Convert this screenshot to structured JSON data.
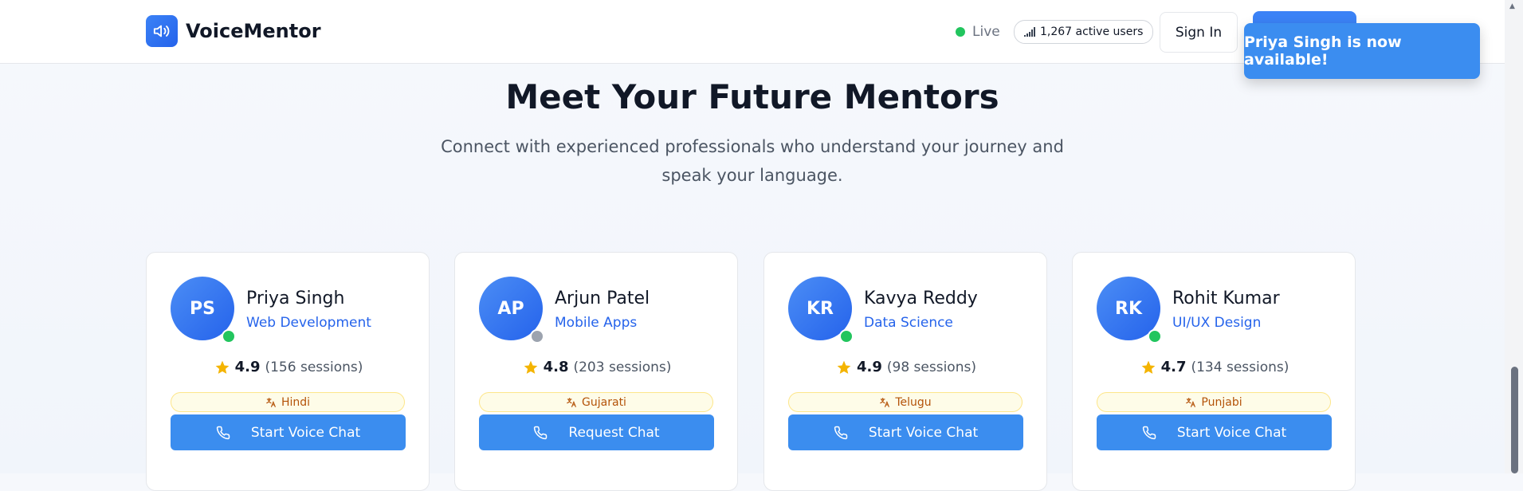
{
  "header": {
    "brand": "VoiceMentor",
    "live_label": "Live",
    "active_users": "1,267 active users",
    "signin_label": "Sign In",
    "toast": "Priya Singh is now available!"
  },
  "hero": {
    "title": "Meet Your Future Mentors",
    "subtitle": "Connect with experienced professionals who understand your journey and speak your language."
  },
  "colors": {
    "online": "#22c55e",
    "offline": "#9ca3af",
    "accent": "#3b82f6"
  },
  "mentors": [
    {
      "initials": "PS",
      "name": "Priya Singh",
      "specialty": "Web Development",
      "rating": "4.9",
      "sessions": "(156 sessions)",
      "language": "Hindi",
      "button": "Start Voice Chat",
      "status": "online"
    },
    {
      "initials": "AP",
      "name": "Arjun Patel",
      "specialty": "Mobile Apps",
      "rating": "4.8",
      "sessions": "(203 sessions)",
      "language": "Gujarati",
      "button": "Request Chat",
      "status": "offline"
    },
    {
      "initials": "KR",
      "name": "Kavya Reddy",
      "specialty": "Data Science",
      "rating": "4.9",
      "sessions": "(98 sessions)",
      "language": "Telugu",
      "button": "Start Voice Chat",
      "status": "online"
    },
    {
      "initials": "RK",
      "name": "Rohit Kumar",
      "specialty": "UI/UX Design",
      "rating": "4.7",
      "sessions": "(134 sessions)",
      "language": "Punjabi",
      "button": "Start Voice Chat",
      "status": "online"
    }
  ]
}
